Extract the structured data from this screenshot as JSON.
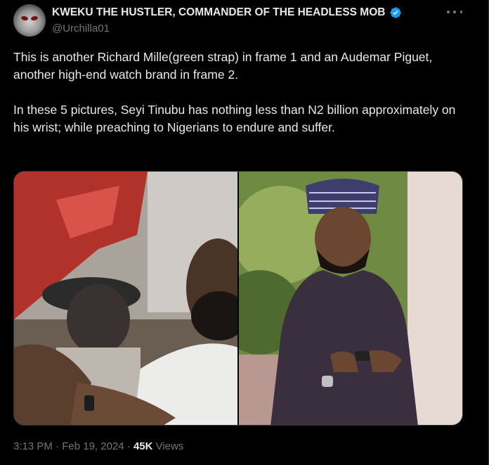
{
  "author": {
    "display_name": "KWEKU THE HUSTLER, COMMANDER OF THE HEADLESS MOB",
    "handle": "@Urchilla01",
    "verified_color": "#1d9bf0"
  },
  "tweet": {
    "paragraphs": [
      "This is another Richard Mille(green strap) in frame 1 and an Audemar Piguet, another high-end watch brand in frame 2.",
      "In these 5 pictures, Seyi Tinubu has nothing less than N2 billion approximately on his wrist; while preaching to Nigerians to endure and suffer."
    ]
  },
  "media": {
    "frames": [
      "frame-1",
      "frame-2"
    ]
  },
  "meta": {
    "time": "3:13 PM",
    "separator": "·",
    "date": "Feb 19, 2024",
    "views_count": "45K",
    "views_label": "Views"
  },
  "colors": {
    "background": "#000000",
    "text": "#e7e9ea",
    "muted": "#71767b",
    "border": "#2f3336"
  }
}
